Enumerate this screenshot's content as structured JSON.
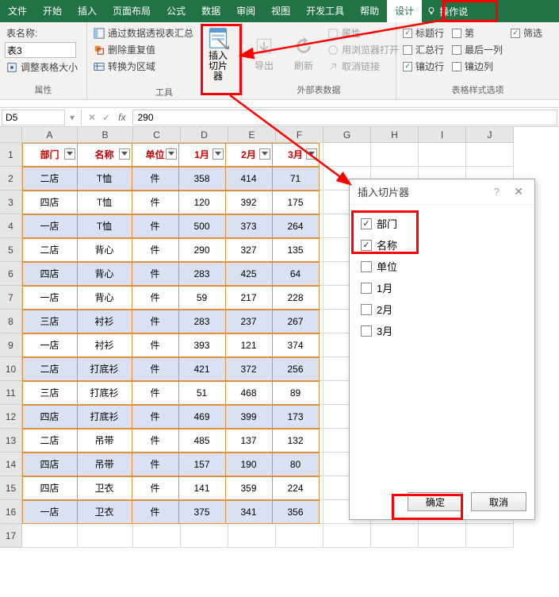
{
  "tabs": [
    "文件",
    "开始",
    "插入",
    "页面布局",
    "公式",
    "数据",
    "审阅",
    "视图",
    "开发工具",
    "帮助",
    "设计"
  ],
  "active_tab": "设计",
  "tell_me": "操作说",
  "table_name_label": "表名称:",
  "table_name_value": "表3",
  "resize_table": "调整表格大小",
  "tools": {
    "pivot": "通过数据透视表汇总",
    "dedup": "删除重复值",
    "convert": "转换为区域",
    "slicer": "插入\n切片器"
  },
  "export": "导出",
  "refresh": "刷新",
  "ext_props": "属性",
  "ext_browser": "用浏览器打开",
  "ext_unlink": "取消链接",
  "style_opts": {
    "header": "标题行",
    "firstcol": "第",
    "filter": "筛选",
    "total": "汇总行",
    "lastcol": "最后一列",
    "banded_row": "镶边行",
    "banded_col": "镶边列"
  },
  "style_checks": {
    "header": true,
    "firstcol": false,
    "filter": true,
    "total": false,
    "lastcol": false,
    "banded_row": true,
    "banded_col": false
  },
  "group_labels": {
    "props": "属性",
    "tools": "工具",
    "ext": "外部表数据",
    "style": "表格样式选项"
  },
  "namebox": "D5",
  "formula": "290",
  "cols": [
    "A",
    "B",
    "C",
    "D",
    "E",
    "F",
    "G",
    "H",
    "I",
    "J"
  ],
  "headers": [
    "部门",
    "名称",
    "单位",
    "1月",
    "2月",
    "3月"
  ],
  "rows": [
    [
      "二店",
      "T恤",
      "件",
      "358",
      "414",
      "71"
    ],
    [
      "四店",
      "T恤",
      "件",
      "120",
      "392",
      "175"
    ],
    [
      "一店",
      "T恤",
      "件",
      "500",
      "373",
      "264"
    ],
    [
      "二店",
      "背心",
      "件",
      "290",
      "327",
      "135"
    ],
    [
      "四店",
      "背心",
      "件",
      "283",
      "425",
      "64"
    ],
    [
      "一店",
      "背心",
      "件",
      "59",
      "217",
      "228"
    ],
    [
      "三店",
      "衬衫",
      "件",
      "283",
      "237",
      "267"
    ],
    [
      "一店",
      "衬衫",
      "件",
      "393",
      "121",
      "374"
    ],
    [
      "二店",
      "打底衫",
      "件",
      "421",
      "372",
      "256"
    ],
    [
      "三店",
      "打底衫",
      "件",
      "51",
      "468",
      "89"
    ],
    [
      "四店",
      "打底衫",
      "件",
      "469",
      "399",
      "173"
    ],
    [
      "二店",
      "吊带",
      "件",
      "485",
      "137",
      "132"
    ],
    [
      "四店",
      "吊带",
      "件",
      "157",
      "190",
      "80"
    ],
    [
      "四店",
      "卫衣",
      "件",
      "141",
      "359",
      "224"
    ],
    [
      "一店",
      "卫衣",
      "件",
      "375",
      "341",
      "356"
    ]
  ],
  "dialog": {
    "title": "插入切片器",
    "fields": [
      "部门",
      "名称",
      "单位",
      "1月",
      "2月",
      "3月"
    ],
    "checked": [
      true,
      true,
      false,
      false,
      false,
      false
    ],
    "ok": "确定",
    "cancel": "取消"
  }
}
